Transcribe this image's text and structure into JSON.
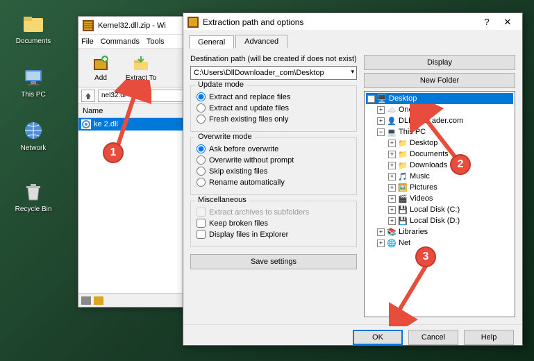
{
  "desktop": {
    "icons": [
      {
        "label": "Documents",
        "name": "documents"
      },
      {
        "label": "This PC",
        "name": "this-pc"
      },
      {
        "label": "Network",
        "name": "network"
      },
      {
        "label": "Recycle Bin",
        "name": "recycle-bin"
      }
    ]
  },
  "winrar": {
    "title": "Kernel32.dll.zip - Wi",
    "menu": [
      "File",
      "Commands",
      "Tools"
    ],
    "toolbar": [
      {
        "label": "Add",
        "name": "add"
      },
      {
        "label": "Extract To",
        "name": "extract-to"
      }
    ],
    "path_value": "nel32.dl",
    "column_header": "Name",
    "file_row": "ke         2.dll"
  },
  "extract": {
    "title": "Extraction path and options",
    "tabs": {
      "general": "General",
      "advanced": "Advanced"
    },
    "dest_label": "Destination path (will be created if does not exist)",
    "dest_value": "C:\\Users\\DllDownloader_com\\Desktop",
    "display_btn": "Display",
    "new_folder_btn": "New Folder",
    "update_mode": {
      "legend": "Update mode",
      "opt1": "Extract and replace files",
      "opt2": "Extract and update files",
      "opt3": "Fresh existing files only"
    },
    "overwrite_mode": {
      "legend": "Overwrite mode",
      "opt1": "Ask before overwrite",
      "opt2": "Overwrite without prompt",
      "opt3": "Skip existing files",
      "opt4": "Rename automatically"
    },
    "misc": {
      "legend": "Miscellaneous",
      "opt1": "Extract archives to subfolders",
      "opt2": "Keep broken files",
      "opt3": "Display files in Explorer"
    },
    "save_btn": "Save settings",
    "tree": {
      "desktop": "Desktop",
      "onedrive": "OneDr",
      "dlldown": "DLL Dow       ader.com",
      "thispc": "This PC",
      "subdesktop": "Desktop",
      "documents": "Documents",
      "downloads": "Downloads",
      "music": "Music",
      "pictures": "Pictures",
      "videos": "Videos",
      "localc": "Local Disk (C:)",
      "locald": "Local Disk (D:)",
      "libraries": "Libraries",
      "network": "Net"
    },
    "footer": {
      "ok": "OK",
      "cancel": "Cancel",
      "help": "Help"
    }
  },
  "annotations": {
    "1": "1",
    "2": "2",
    "3": "3"
  }
}
